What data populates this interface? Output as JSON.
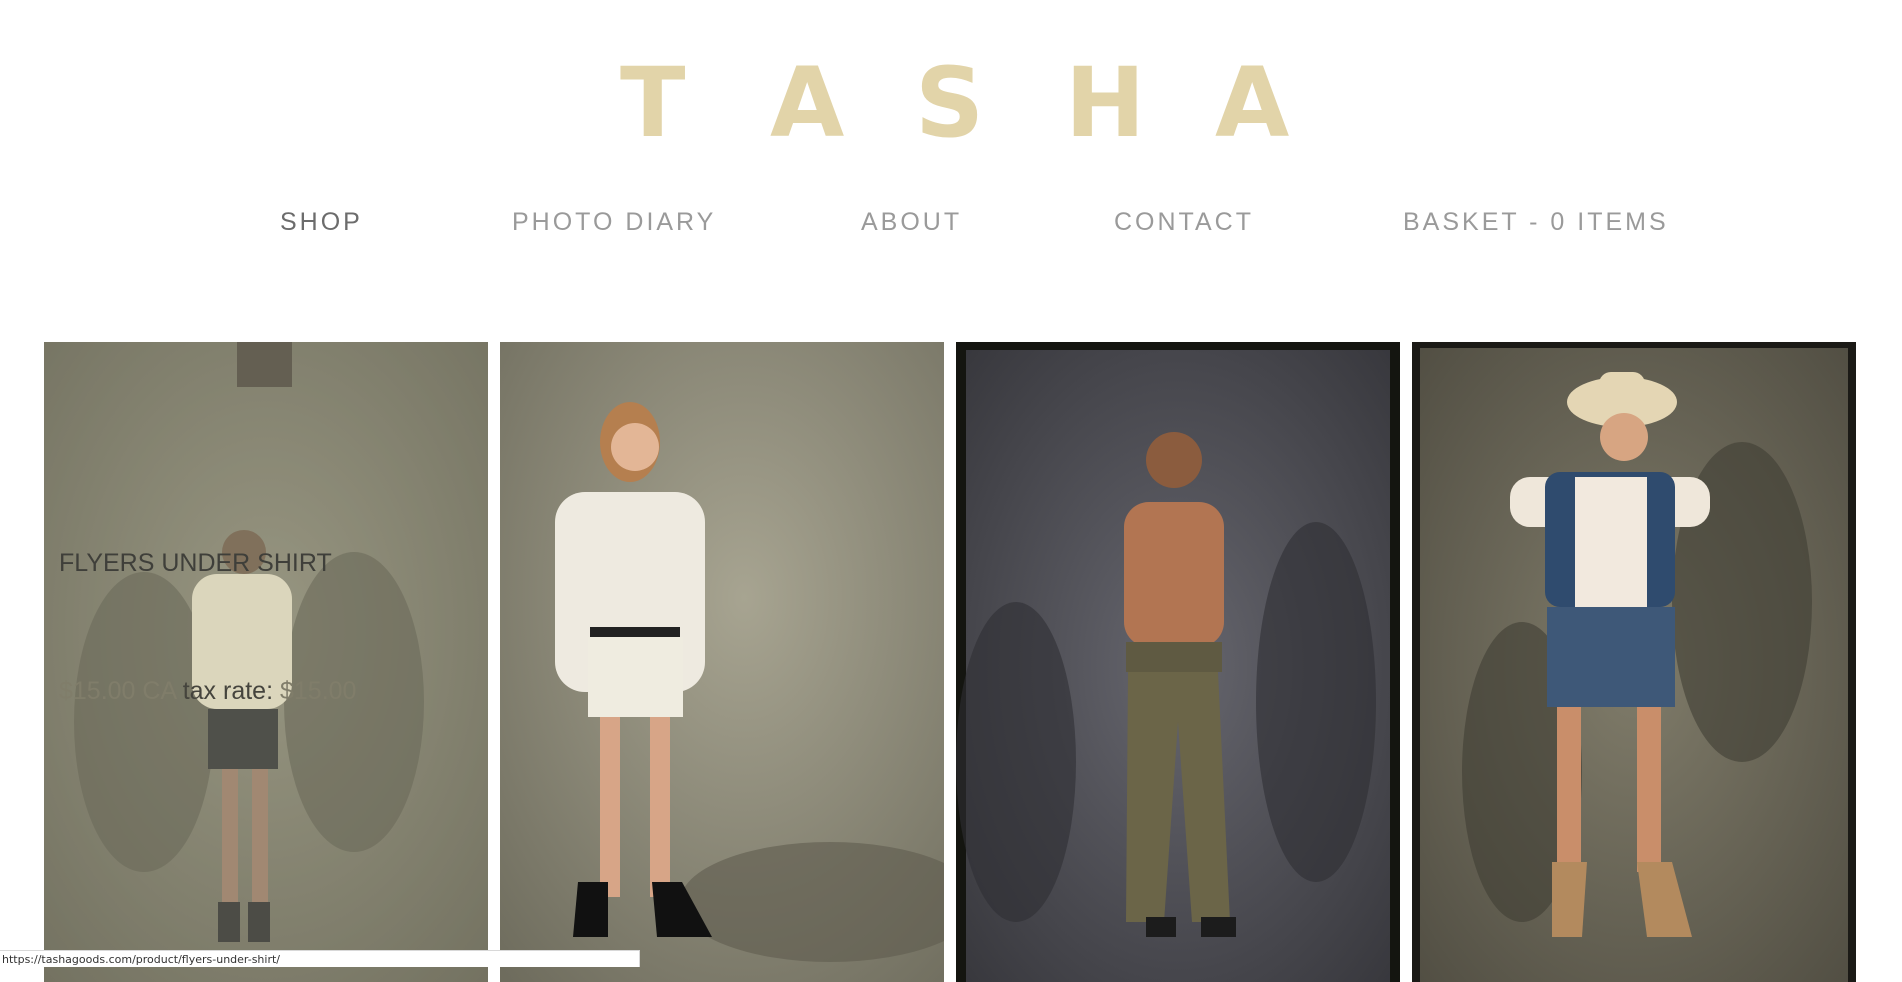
{
  "logo": {
    "letters": [
      "T",
      "A",
      "S",
      "H",
      "A"
    ],
    "color": "#e2d4a9"
  },
  "nav": {
    "items": [
      {
        "label": "SHOP",
        "active": true
      },
      {
        "label": "PHOTO DIARY",
        "active": false
      },
      {
        "label": "ABOUT",
        "active": false
      },
      {
        "label": "CONTACT",
        "active": false
      },
      {
        "label": "BASKET - 0 ITEMS",
        "active": false
      }
    ]
  },
  "products": [
    {
      "title": "FLYERS UNDER SHIRT",
      "price_prefix": "$15.00 CA",
      "tax_label": " tax rate: ",
      "price_suffix": "$15.00",
      "hovered": true
    },
    {
      "title": "",
      "hovered": false
    },
    {
      "title": "",
      "hovered": false
    },
    {
      "title": "",
      "hovered": false
    }
  ],
  "status_bar": {
    "url": "https://tashagoods.com/product/flyers-under-shirt/"
  }
}
